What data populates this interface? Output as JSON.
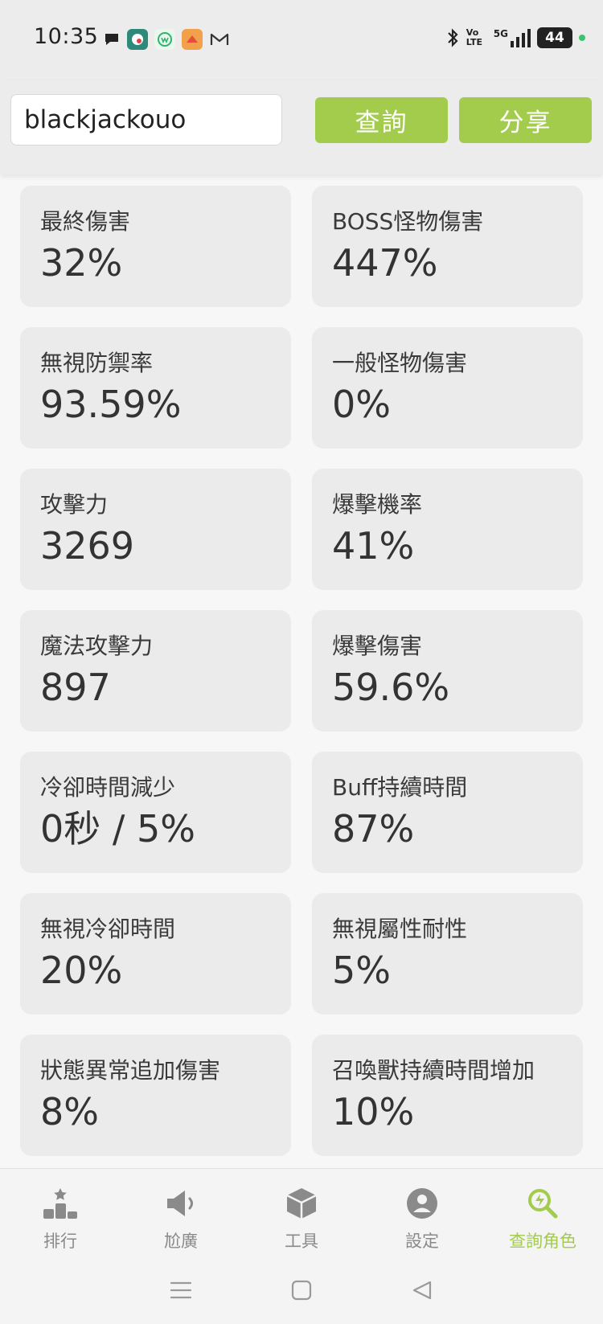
{
  "status_bar": {
    "time": "10:35",
    "signal_text": "5G",
    "volte_text": "Vo LTE",
    "battery": "44"
  },
  "search": {
    "value": "blackjackouo",
    "query_label": "查詢",
    "share_label": "分享"
  },
  "accent_color": "#a3cb4c",
  "stats": [
    {
      "label": "最終傷害",
      "value": "32%"
    },
    {
      "label": "BOSS怪物傷害",
      "value": "447%"
    },
    {
      "label": "無視防禦率",
      "value": "93.59%"
    },
    {
      "label": "一般怪物傷害",
      "value": "0%"
    },
    {
      "label": "攻擊力",
      "value": "3269"
    },
    {
      "label": "爆擊機率",
      "value": "41%"
    },
    {
      "label": "魔法攻擊力",
      "value": "897"
    },
    {
      "label": "爆擊傷害",
      "value": "59.6%"
    },
    {
      "label": "冷卻時間減少",
      "value": "0秒 / 5%"
    },
    {
      "label": "Buff持續時間",
      "value": "87%"
    },
    {
      "label": "無視冷卻時間",
      "value": "20%"
    },
    {
      "label": "無視屬性耐性",
      "value": "5%"
    },
    {
      "label": "狀態異常追加傷害",
      "value": "8%"
    },
    {
      "label": "召喚獸持續時間增加",
      "value": "10%"
    }
  ],
  "bottom_nav": [
    {
      "label": "排行",
      "icon": "podium-icon"
    },
    {
      "label": "尬廣",
      "icon": "megaphone-icon"
    },
    {
      "label": "工具",
      "icon": "box-icon"
    },
    {
      "label": "設定",
      "icon": "account-icon"
    },
    {
      "label": "查詢角色",
      "icon": "search-character-icon"
    }
  ]
}
